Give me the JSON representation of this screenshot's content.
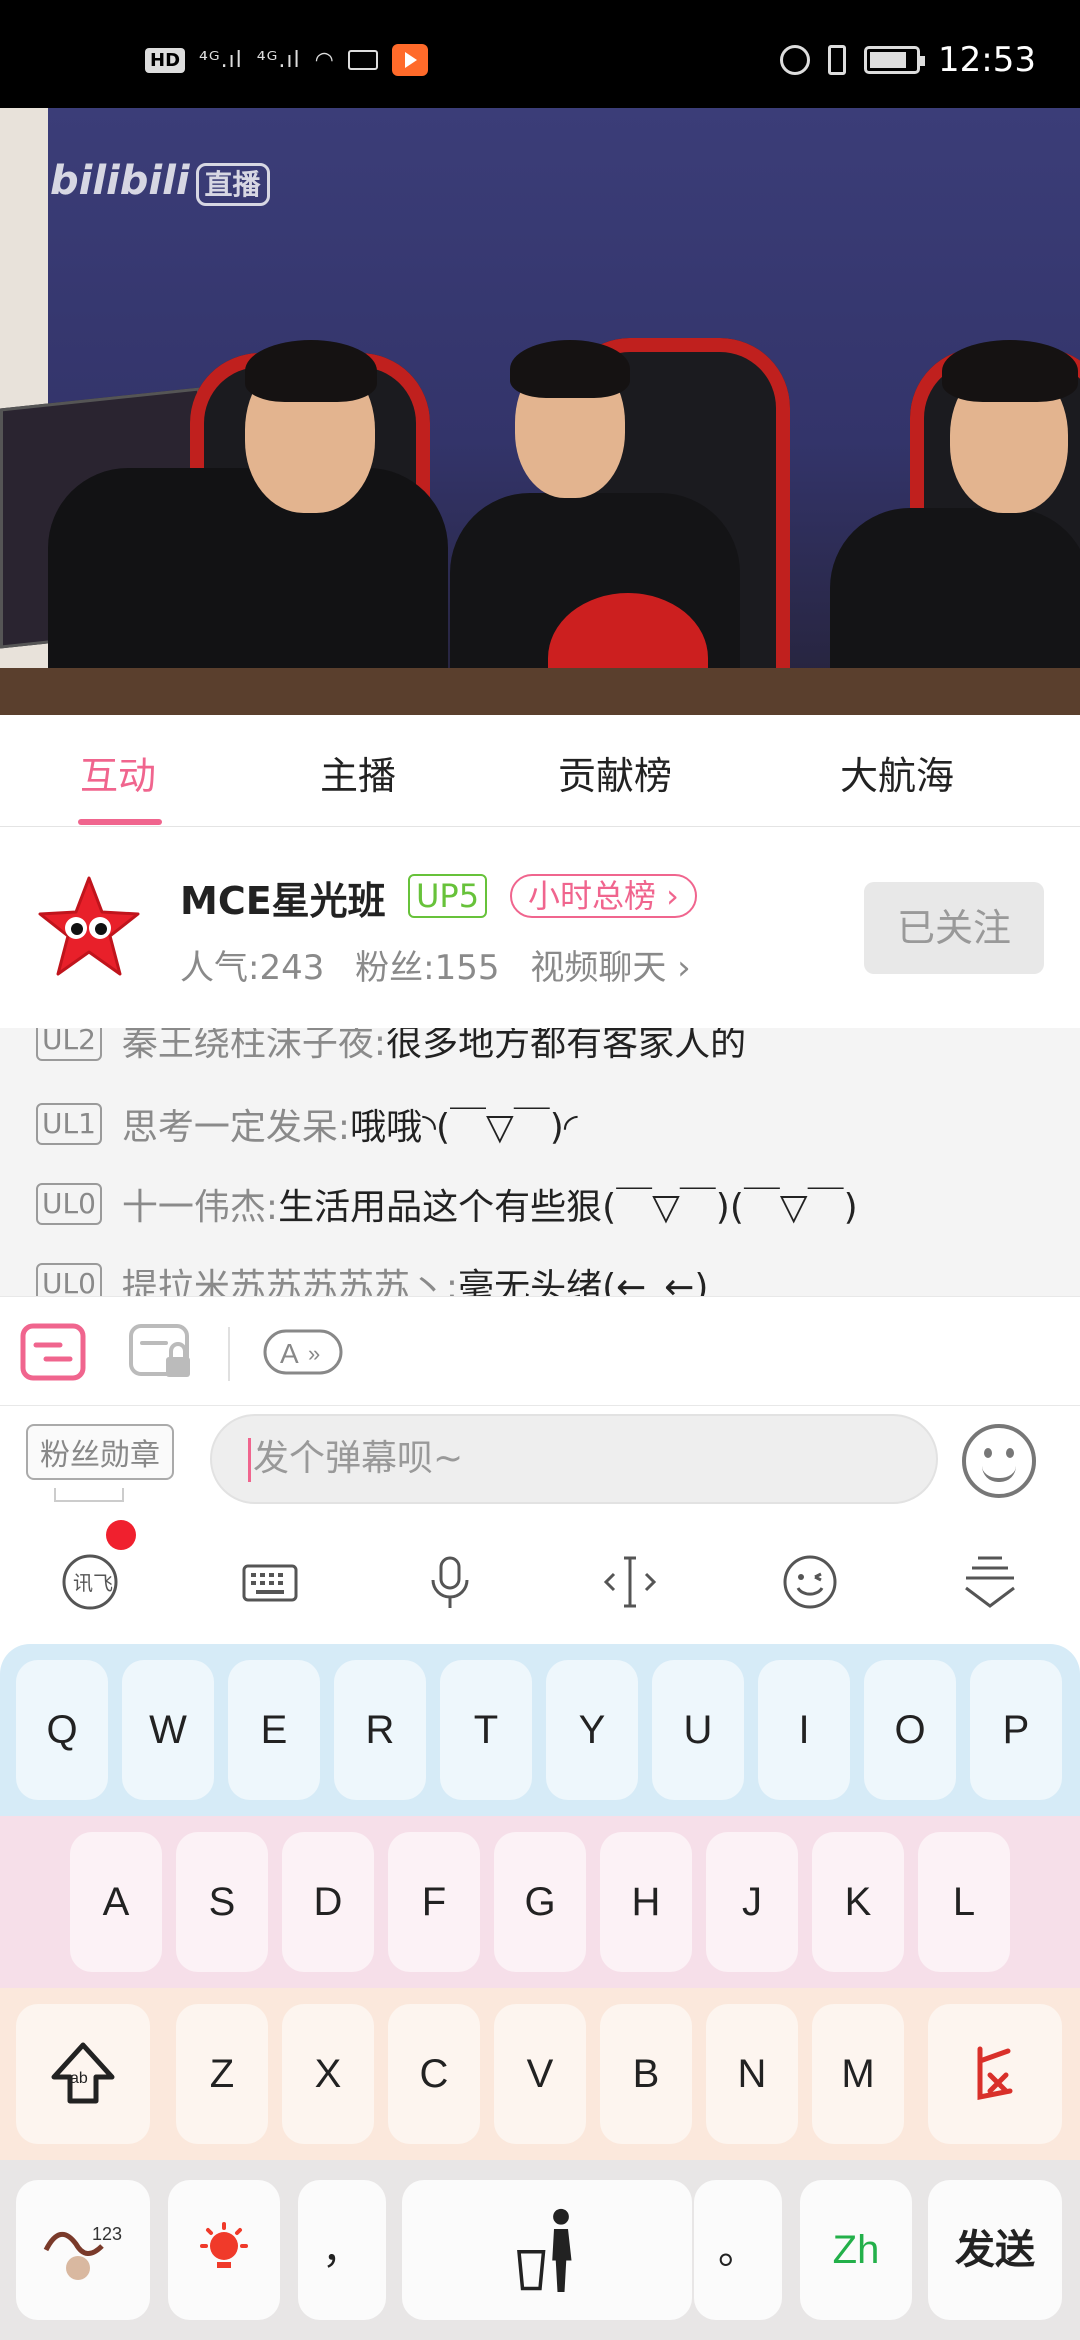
{
  "status_bar": {
    "left_badge": "HD",
    "signal_1": "⁴ᴳ.ıl",
    "signal_2": "⁴ᴳ.ıl",
    "time": "12:53"
  },
  "video": {
    "watermark_brand": "bilibili",
    "watermark_live": "直播"
  },
  "tabs": [
    {
      "label": "互动",
      "active": true
    },
    {
      "label": "主播",
      "active": false
    },
    {
      "label": "贡献榜",
      "active": false
    },
    {
      "label": "大航海",
      "active": false
    }
  ],
  "anchor": {
    "name": "MCE星光班",
    "up_level": "UP5",
    "rank_label": "小时总榜 ›",
    "popularity": "人气:243",
    "fans": "粉丝:155",
    "video_chat": "视频聊天 ›",
    "follow_label": "已关注"
  },
  "chat": [
    {
      "level": "UL2",
      "user": "秦王绕柱沫子夜:",
      "message": " 很多地方都有客家人的"
    },
    {
      "level": "UL1",
      "user": "思考一定发呆:",
      "message": " 哦哦◝(￣▽￣)◜"
    },
    {
      "level": "UL0",
      "user": "十一伟杰:",
      "message": " 生活用品这个有些狠(￣▽￣)(￣▽￣)"
    },
    {
      "level": "UL0",
      "user": "提拉米苏苏苏苏苏丶:",
      "message": " 毫无头绪(←_←)"
    }
  ],
  "input": {
    "fan_medal": "粉丝勋章",
    "placeholder": "发个弹幕呗~"
  },
  "keyboard": {
    "row1": [
      "Q",
      "W",
      "E",
      "R",
      "T",
      "Y",
      "U",
      "I",
      "O",
      "P"
    ],
    "row2": [
      "A",
      "S",
      "D",
      "F",
      "G",
      "H",
      "J",
      "K",
      "L"
    ],
    "row3": [
      "Z",
      "X",
      "C",
      "V",
      "B",
      "N",
      "M"
    ],
    "comma": "，",
    "period": "。",
    "lang": "Zh",
    "send": "发送",
    "numbers_small": "123"
  },
  "colors": {
    "accent_pink": "#f0658e",
    "up_green": "#67c23a",
    "row1_bg": "#d6ebf7",
    "row2_bg": "#f6dfe9",
    "row3_bg": "#fbe8dc",
    "row4_bg": "#e8e6e6"
  }
}
